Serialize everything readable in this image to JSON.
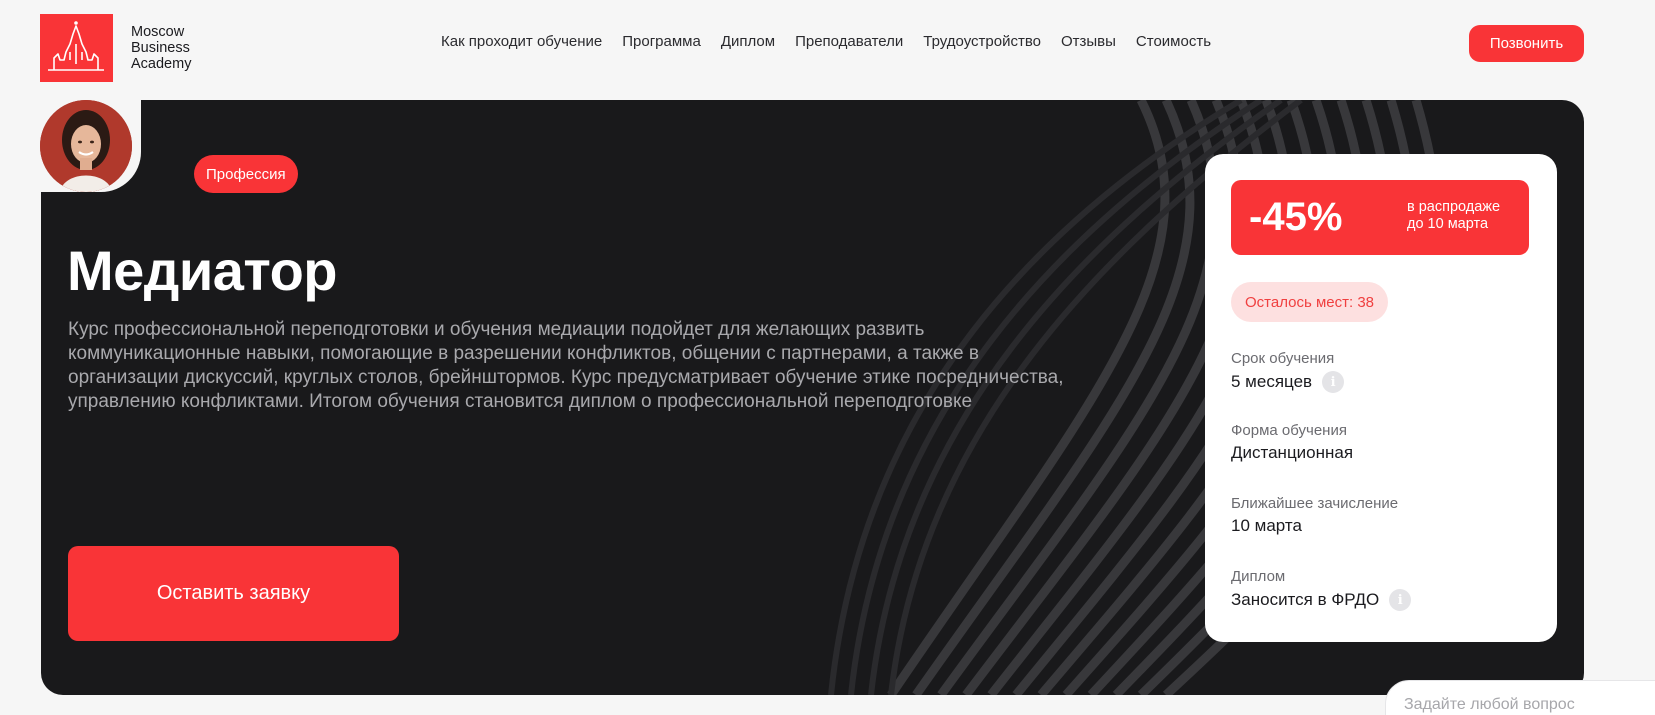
{
  "header": {
    "logo_lines": [
      "Moscow",
      "Business",
      "Academy"
    ],
    "nav": [
      "Как проходит обучение",
      "Программа",
      "Диплом",
      "Преподаватели",
      "Трудоустройство",
      "Отзывы",
      "Стоимость"
    ],
    "call_label": "Позвонить"
  },
  "hero": {
    "badge": "Профессия",
    "title": "Медиатор",
    "description": "Курс профессиональной переподготовки и обучения медиации подойдет для желающих развить коммуникационные навыки, помогающие в разрешении конфликтов, общении с партнерами, а также в организации дискуссий, круглых столов, брейнштормов. Курс предусматривает обучение этике посредничества, управлению конфликтами. Итогом обучения становится диплом о профессиональной переподготовке",
    "apply_label": "Оставить заявку"
  },
  "card": {
    "discount_value": "-45%",
    "discount_note_1": "в распродаже",
    "discount_note_2": "до 10 марта",
    "seats": "Осталось мест: 38",
    "duration_label": "Срок обучения",
    "duration_value": "5 месяцев",
    "form_label": "Форма обучения",
    "form_value": "Дистанционная",
    "enrollment_label": "Ближайшее зачисление",
    "enrollment_value": "10 марта",
    "diploma_label": "Диплом",
    "diploma_value": "Заносится в ФРДО"
  },
  "chat": {
    "placeholder": "Задайте любой вопрос"
  },
  "colors": {
    "accent": "#f93437",
    "hero_bg": "#19191b",
    "page_bg": "#f6f6f6"
  }
}
